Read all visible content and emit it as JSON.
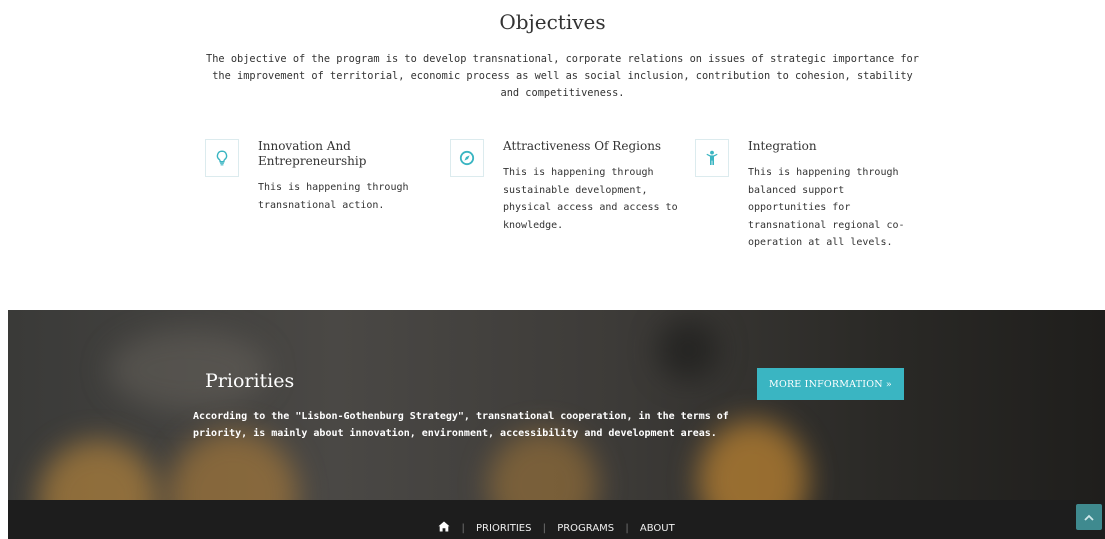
{
  "objectives": {
    "title": "Objectives",
    "description": "The objective of the program is to develop transnational, corporate relations on issues of strategic importance for the improvement of territorial, economic process as well as social inclusion, contribution to cohesion, stability and competitiveness."
  },
  "features": [
    {
      "icon": "lightbulb-icon",
      "title": "Innovation And Entrepreneurship",
      "text": "This is happening through transnational action."
    },
    {
      "icon": "compass-icon",
      "title": "Attractiveness Of Regions",
      "text": "This is happening through sustainable development, physical access and access to knowledge."
    },
    {
      "icon": "person-icon",
      "title": "Integration",
      "text": "This is happening through balanced support opportunities for transnational regional co-operation at all levels."
    }
  ],
  "priorities": {
    "title": "Priorities",
    "text": "According to the \"Lisbon-Gothenburg Strategy\", transnational cooperation, in the terms of priority, is mainly about innovation, environment, accessibility and development areas.",
    "button_label": "MORE INFORMATION »"
  },
  "footer": {
    "nav": [
      {
        "label": "PRIORITIES"
      },
      {
        "label": "PROGRAMS"
      },
      {
        "label": "ABOUT"
      }
    ]
  },
  "colors": {
    "accent": "#3ab5c2",
    "footer_bg": "#1d1d1d",
    "scroll_button": "#3f8a8f"
  }
}
